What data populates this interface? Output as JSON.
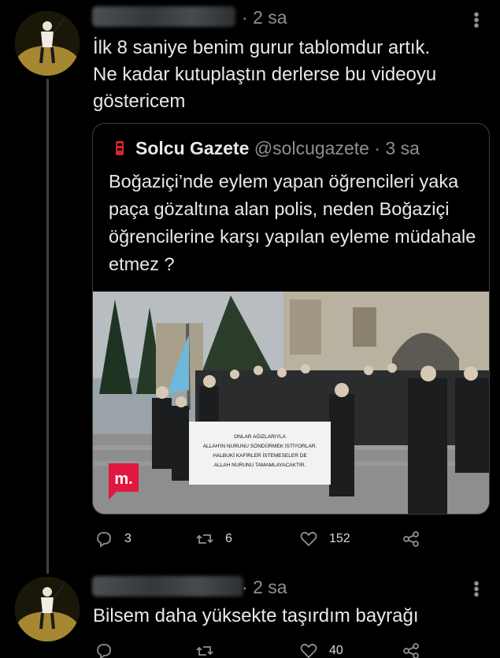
{
  "tweets": [
    {
      "time": "2 sa",
      "text": "İlk 8 saniye benim gurur tablomdur artık.\nNe kadar kutuplaştın derlerse bu videoyu\ngöstericem",
      "quote": {
        "name": "Solcu Gazete",
        "handle": "@solcugazete",
        "time": "3 sa",
        "text": "Boğaziçi’nde eylem yapan öğrencileri yaka paça gözaltına alan polis, neden Boğaziçi öğrencilerine karşı yapılan eyleme müdahale etmez ?",
        "media": {
          "banner_lines": [
            "ONLAR AĞIZLARIYLA",
            "ALLAH'IN NURUNU SÖNDÜRMEK İSTİYORLAR.",
            "HALBUKİ KAFİRLER İSTEMESELER DE",
            "ALLAH NURUNU TAMAMLAYACAKTIR."
          ],
          "watermark": "m."
        }
      },
      "replies": "3",
      "retweets": "6",
      "likes": "152"
    },
    {
      "time": "2 sa",
      "text": "Bilsem daha yüksekte taşırdım bayrağı",
      "likes": "40"
    }
  ],
  "colors": {
    "background": "#000000",
    "muted": "#8b9196",
    "text": "#e7e9ea",
    "border": "#3a3d40"
  },
  "icons": [
    "reply-icon",
    "retweet-icon",
    "like-icon",
    "share-icon",
    "more-options-icon"
  ]
}
